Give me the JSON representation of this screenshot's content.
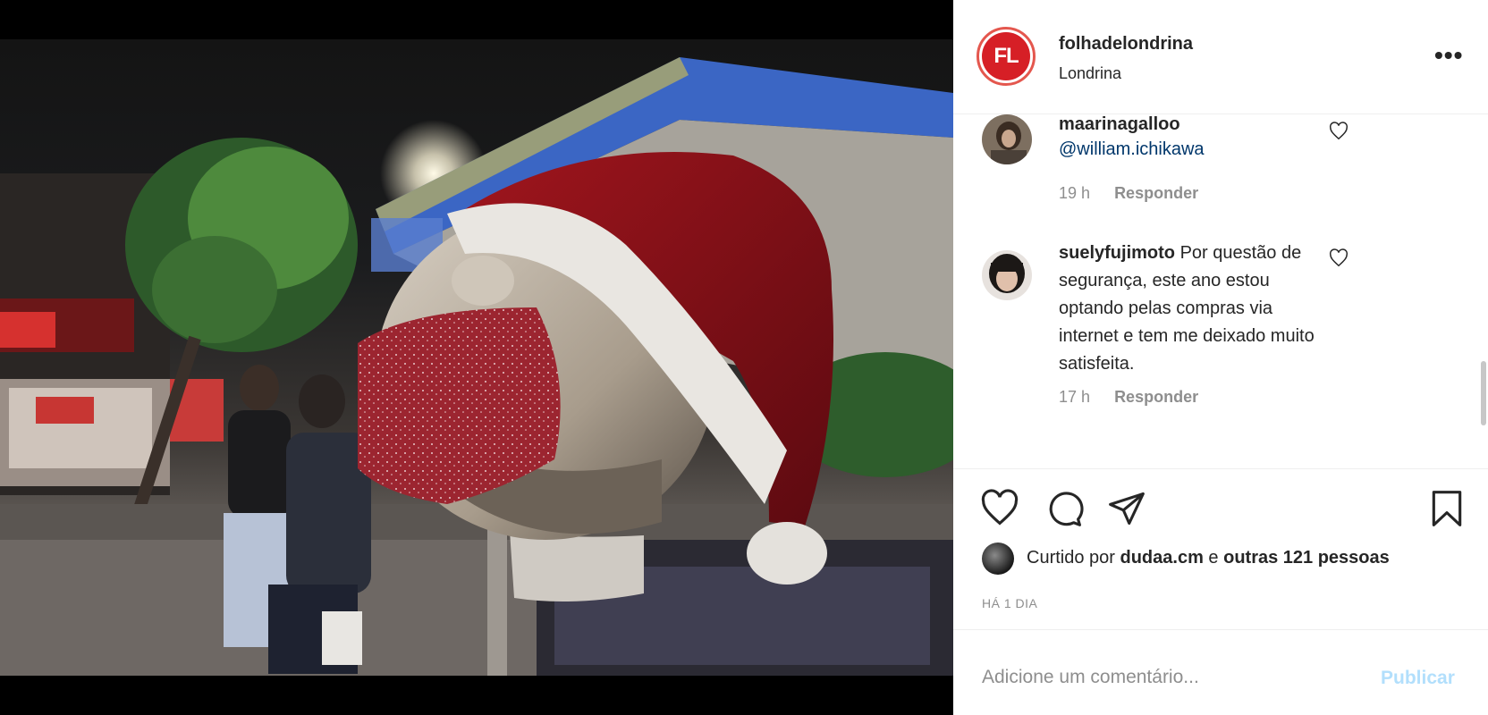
{
  "post": {
    "username": "folhadelondrina",
    "location": "Londrina",
    "logo_text": "FL",
    "more_icon": "more-horizontal-icon"
  },
  "comments": [
    {
      "username": "maarinagalloo",
      "mention": "@william.ichikawa",
      "time": "19 h",
      "reply": "Responder"
    },
    {
      "username": "suelyfujimoto",
      "text_lines": [
        "Por questão de",
        "segurança, este ano estou",
        "optando pelas compras via",
        "internet e tem me deixado muito",
        "satisfeita."
      ],
      "time": "17 h",
      "reply": "Responder"
    }
  ],
  "actions": {
    "icons": [
      "heart-icon",
      "comment-icon",
      "share-icon",
      "bookmark-icon"
    ]
  },
  "likes": {
    "prefix": "Curtido por",
    "user": "dudaa.cm",
    "middle": "e",
    "others": "outras 121 pessoas"
  },
  "date": "HÁ 1 DIA",
  "comment_box": {
    "placeholder": "Adicione um comentário...",
    "publish_label": "Publicar"
  },
  "colors": {
    "logo_red": "#d61f26",
    "mention_blue": "#00376b",
    "publish_disabled": "#b2dffc",
    "meta_gray": "#8e8e8e"
  }
}
